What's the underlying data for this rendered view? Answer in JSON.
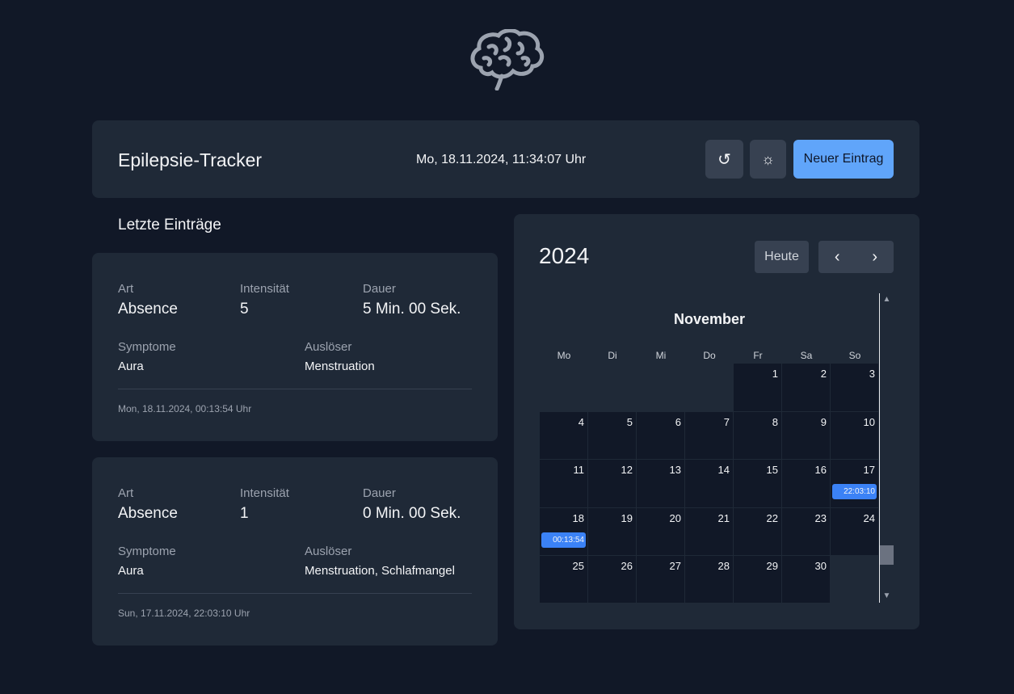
{
  "header": {
    "title": "Epilepsie-Tracker",
    "datetime": "Mo, 18.11.2024, 11:34:07 Uhr",
    "refresh_icon": "↺",
    "theme_icon": "☼",
    "new_entry_label": "Neuer Eintrag"
  },
  "entries_section": {
    "title": "Letzte Einträge"
  },
  "entries": [
    {
      "art_label": "Art",
      "art": "Absence",
      "intensity_label": "Intensität",
      "intensity": "5",
      "duration_label": "Dauer",
      "duration": "5 Min. 00 Sek.",
      "symptoms_label": "Symptome",
      "symptoms": "Aura",
      "triggers_label": "Auslöser",
      "triggers": "Menstruation",
      "timestamp": "Mon, 18.11.2024, 00:13:54 Uhr"
    },
    {
      "art_label": "Art",
      "art": "Absence",
      "intensity_label": "Intensität",
      "intensity": "1",
      "duration_label": "Dauer",
      "duration": "0 Min. 00 Sek.",
      "symptoms_label": "Symptome",
      "symptoms": "Aura",
      "triggers_label": "Auslöser",
      "triggers": "Menstruation, Schlafmangel",
      "timestamp": "Sun, 17.11.2024, 22:03:10 Uhr"
    }
  ],
  "calendar": {
    "year": "2024",
    "today_label": "Heute",
    "prev_icon": "‹",
    "next_icon": "›",
    "month": "November",
    "weekdays": [
      "Mo",
      "Di",
      "Mi",
      "Do",
      "Fr",
      "Sa",
      "So"
    ],
    "first_weekday_index": 4,
    "days_in_month": 30,
    "events": [
      {
        "day": 17,
        "label": "22:03:10"
      },
      {
        "day": 18,
        "label": "00:13:54"
      }
    ],
    "scroll_up_icon": "▲",
    "scroll_down_icon": "▼"
  },
  "colors": {
    "background": "#111827",
    "panel": "#1f2937",
    "accent": "#60a5fa",
    "event": "#3b82f6"
  }
}
